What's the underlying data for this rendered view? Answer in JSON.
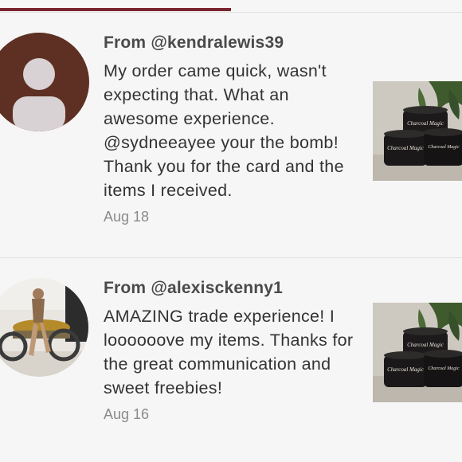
{
  "reviews": [
    {
      "reviewer": "From @kendralewis39",
      "text": "My order came quick, wasn't expecting that. What an awesome experience. @sydneeayee your the bomb! Thank you for the card and the items I received.",
      "date": "Aug 18",
      "avatar_icon": "default-user-avatar-icon",
      "product_label": "Charcoal Magic"
    },
    {
      "reviewer": "From @alexisckenny1",
      "text": "AMAZING trade experience! I loooooove my items. Thanks for the great communication and sweet freebies!",
      "date": "Aug 16",
      "avatar_icon": "user-photo-avatar",
      "product_label": "Charcoal Magic"
    }
  ],
  "colors": {
    "accent": "#7a2430",
    "avatar_bg": "#5e3023",
    "text": "#333333",
    "muted": "#8a8a8a"
  }
}
